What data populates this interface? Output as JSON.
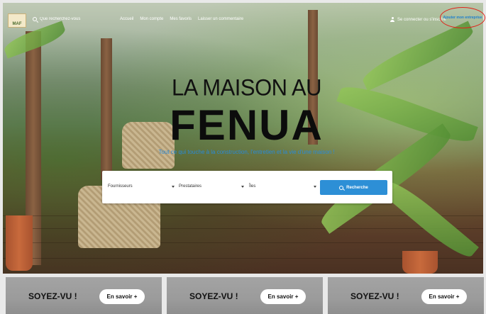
{
  "header": {
    "logo_text": "MAF",
    "search_placeholder": "Que recherchez-vous ?",
    "nav": [
      "Accueil",
      "Mon compte",
      "Mes favoris",
      "Laisser un commentaire"
    ],
    "login_label": "Se connecter ou s'inscrire",
    "add_business_label": "Ajouter mon entreprise"
  },
  "hero": {
    "title_line1": "LA MAISON AU",
    "title_line2": "FENUA",
    "subtitle": "Tout ce qui touche à la construction, l'entretien et la vie d'une maison !"
  },
  "search_form": {
    "select_suppliers": "Fournisseurs",
    "select_providers": "Prestataires",
    "select_islands": "Îles",
    "button_label": "Recherche"
  },
  "cards": [
    {
      "title": "SOYEZ-VU !",
      "button": "En savoir +"
    },
    {
      "title": "SOYEZ-VU !",
      "button": "En savoir +"
    },
    {
      "title": "SOYEZ-VU !",
      "button": "En savoir +"
    }
  ],
  "colors": {
    "accent_blue": "#2d8fd6",
    "subtitle_blue": "#2a8ad8",
    "highlight_red": "#e0241b"
  }
}
